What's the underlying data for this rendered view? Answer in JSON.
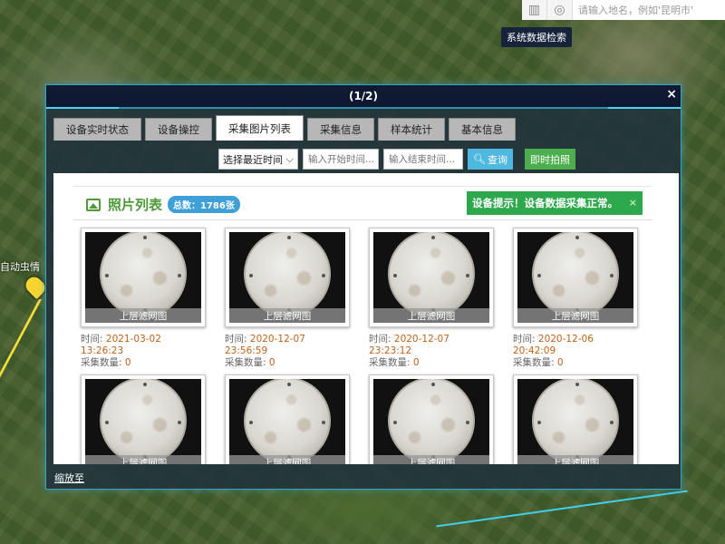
{
  "map": {
    "search_placeholder": "请输入地名，例如'昆明市'",
    "tooltip": "系统数据检索",
    "label": "自动虫情",
    "tools": [
      "chart-icon",
      "locate-icon"
    ]
  },
  "dialog": {
    "title": "(1/2)",
    "close": "×",
    "zoom_link": "缩放至",
    "tabs": [
      {
        "label": "设备实时状态",
        "active": false
      },
      {
        "label": "设备操控",
        "active": false
      },
      {
        "label": "采集图片列表",
        "active": true
      },
      {
        "label": "采集信息",
        "active": false
      },
      {
        "label": "样本统计",
        "active": false
      },
      {
        "label": "基本信息",
        "active": false
      }
    ],
    "filter": {
      "select_value": "选择最近时间",
      "start_placeholder": "输入开始时间...",
      "end_placeholder": "输入结束时间...",
      "query_label": "查询",
      "snap_label": "即时拍照"
    },
    "panel": {
      "title": "照片列表",
      "total": "总数：1786张",
      "alert": "设备提示！设备数据采集正常。",
      "alert_close": "×"
    },
    "photos": [
      {
        "caption": "上层滤网图",
        "time_label": "时间:",
        "time": "2021-03-02  13:26:23",
        "count_label": "采集数量:",
        "count": "0"
      },
      {
        "caption": "上层滤网图",
        "time_label": "时间:",
        "time": "2020-12-07 23:56:59",
        "count_label": "采集数量:",
        "count": "0"
      },
      {
        "caption": "上层滤网图",
        "time_label": "时间:",
        "time": "2020-12-07 23:23:12",
        "count_label": "采集数量:",
        "count": "0"
      },
      {
        "caption": "上层滤网图",
        "time_label": "时间:",
        "time": "2020-12-06 20:42:09",
        "count_label": "采集数量:",
        "count": "0"
      },
      {
        "caption": "上层滤网图"
      },
      {
        "caption": "上层滤网图"
      },
      {
        "caption": "上层滤网图"
      },
      {
        "caption": "上层滤网图"
      }
    ]
  },
  "colors": {
    "accent_green": "#4e9a3a",
    "badge_blue": "#3fa0d8",
    "alert_green": "#2ea84c",
    "time_orange": "#c0621c",
    "query_blue": "#4fb8de",
    "snap_green": "#4cae4c",
    "dialog_border": "#3aa3c0"
  }
}
